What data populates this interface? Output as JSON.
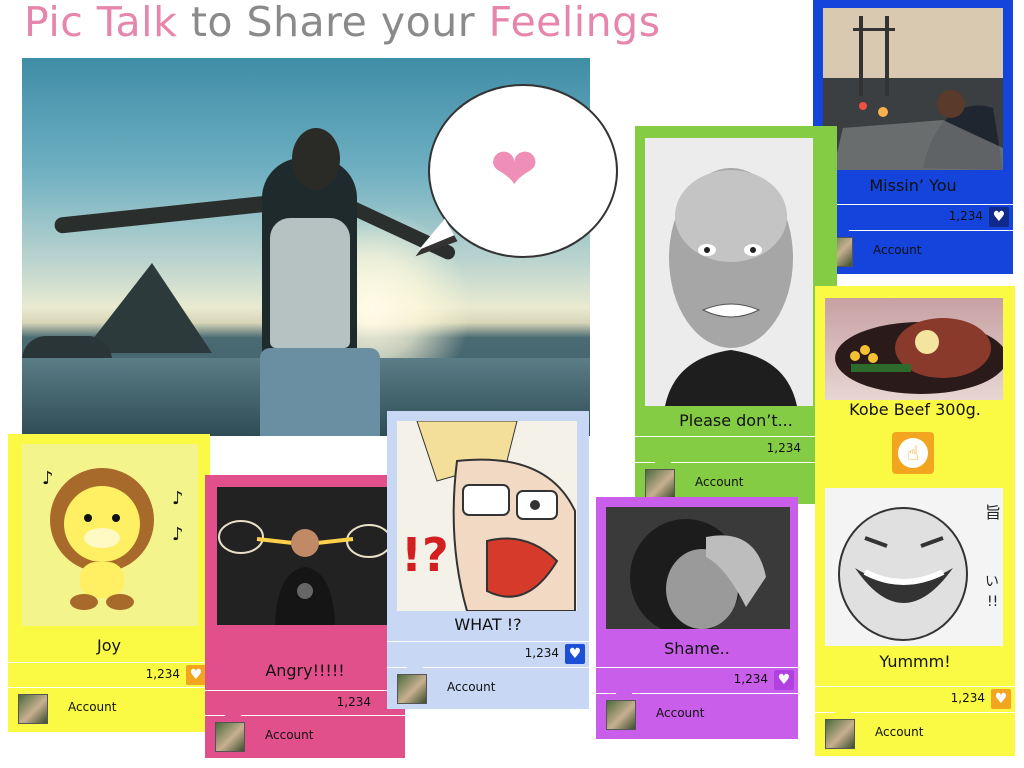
{
  "title": {
    "part1": "Pic Talk",
    "part2": " to Share your ",
    "part3": "Feelings"
  },
  "hero": {
    "bubble_icon": "heart-icon"
  },
  "cards": [
    {
      "id": "joy",
      "caption": "Joy",
      "count": "1,234",
      "account": "Account"
    },
    {
      "id": "angry",
      "caption": "Angry!!!!!",
      "count": "1,234",
      "account": "Account"
    },
    {
      "id": "what",
      "caption": "WHAT !?",
      "count": "1,234",
      "account": "Account"
    },
    {
      "id": "please",
      "caption": "Please don’t...",
      "count": "1,234",
      "account": "Account"
    },
    {
      "id": "shame",
      "caption": "Shame..",
      "count": "1,234",
      "account": "Account"
    },
    {
      "id": "missin",
      "caption": "Missin’ You",
      "count": "1,234",
      "account": "Account"
    },
    {
      "id": "kobe",
      "caption_top": "Kobe Beef 300g.",
      "caption": "Yummm!",
      "count": "1,234",
      "account": "Account",
      "pointer_icon": "pointing-hand-icon"
    }
  ],
  "colors": {
    "pink": "#e786ac",
    "gray": "#8a8a8a",
    "yellow": "#fafa44",
    "orange": "#f2a61f",
    "blue": "#1444dc",
    "green": "#84cc44",
    "purple": "#c85ee9",
    "magenta": "#e2508c",
    "lightblue": "#c8d8f4"
  }
}
